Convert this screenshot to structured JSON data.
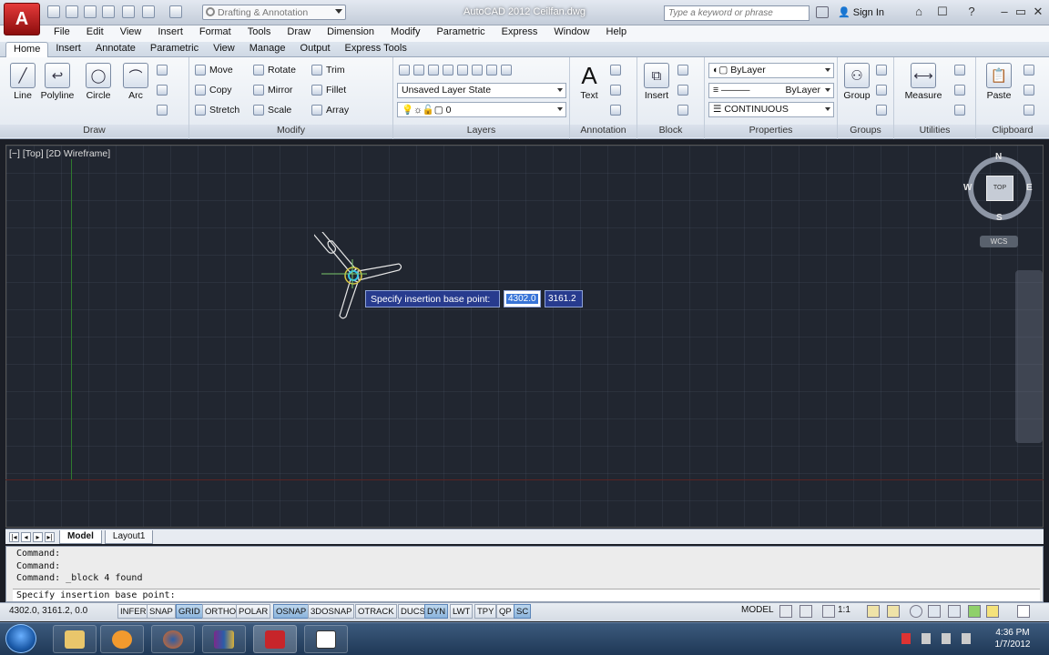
{
  "titlebar": {
    "app_title": "AutoCAD 2012    Ceilfan.dwg",
    "workspace": "Drafting & Annotation",
    "search_placeholder": "Type a keyword or phrase",
    "sign_in": "Sign In"
  },
  "menu": [
    "File",
    "Edit",
    "View",
    "Insert",
    "Format",
    "Tools",
    "Draw",
    "Dimension",
    "Modify",
    "Parametric",
    "Express",
    "Window",
    "Help"
  ],
  "ribbon_tabs": [
    "Home",
    "Insert",
    "Annotate",
    "Parametric",
    "View",
    "Manage",
    "Output",
    "Express Tools"
  ],
  "ribbon": {
    "draw": {
      "label": "Draw",
      "tools": [
        "Line",
        "Polyline",
        "Circle",
        "Arc"
      ]
    },
    "modify": {
      "label": "Modify",
      "rows": [
        [
          "Move",
          "Rotate",
          "Trim"
        ],
        [
          "Copy",
          "Mirror",
          "Fillet"
        ],
        [
          "Stretch",
          "Scale",
          "Array"
        ]
      ]
    },
    "layers": {
      "label": "Layers",
      "layer_state": "Unsaved Layer State",
      "current_layer": "0"
    },
    "annotation": {
      "label": "Annotation",
      "text": "Text"
    },
    "block": {
      "label": "Block",
      "insert": "Insert"
    },
    "properties": {
      "label": "Properties",
      "color": "ByLayer",
      "lineweight": "ByLayer",
      "linetype": "CONTINUOUS"
    },
    "groups": {
      "label": "Groups",
      "group": "Group"
    },
    "utilities": {
      "label": "Utilities",
      "measure": "Measure"
    },
    "clipboard": {
      "label": "Clipboard",
      "paste": "Paste"
    }
  },
  "viewport": {
    "label": "[−] [Top] [2D Wireframe]",
    "viewcube": {
      "top": "TOP",
      "n": "N",
      "s": "S",
      "e": "E",
      "w": "W",
      "wcs": "WCS"
    },
    "dynamic_input": {
      "prompt": "Specify insertion base point:",
      "x": "4302.0",
      "y": "3161.2"
    }
  },
  "layout_tabs": [
    "Model",
    "Layout1"
  ],
  "command_line": {
    "history": [
      "Command:",
      "Command:",
      "Command: _block 4 found"
    ],
    "current": "Specify insertion base point:"
  },
  "statusbar": {
    "coords": "4302.0,  3161.2, 0.0",
    "toggles": [
      {
        "label": "INFER",
        "on": false
      },
      {
        "label": "SNAP",
        "on": false
      },
      {
        "label": "GRID",
        "on": true
      },
      {
        "label": "ORTHO",
        "on": false
      },
      {
        "label": "POLAR",
        "on": false
      },
      {
        "label": "OSNAP",
        "on": true
      },
      {
        "label": "3DOSNAP",
        "on": false
      },
      {
        "label": "OTRACK",
        "on": false
      },
      {
        "label": "DUCS",
        "on": false
      },
      {
        "label": "DYN",
        "on": true
      },
      {
        "label": "LWT",
        "on": false
      },
      {
        "label": "TPY",
        "on": false
      },
      {
        "label": "QP",
        "on": false
      },
      {
        "label": "SC",
        "on": true
      }
    ],
    "model": "MODEL",
    "anno_scale": "1:1"
  },
  "taskbar": {
    "apps": [
      "windows-explorer",
      "media-player",
      "firefox",
      "winrar",
      "autocad",
      "window"
    ],
    "time": "4:36 PM",
    "date": "1/7/2012"
  }
}
